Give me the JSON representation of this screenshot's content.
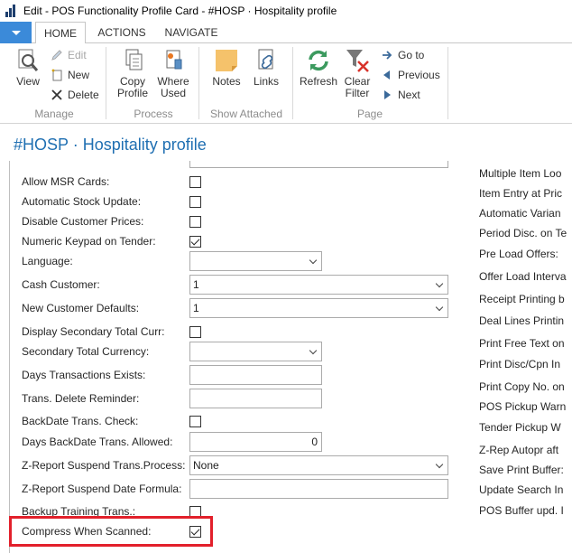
{
  "window": {
    "title": "Edit - POS Functionality Profile Card - #HOSP · Hospitality profile"
  },
  "ribbon": {
    "tabs": [
      {
        "label": "HOME"
      },
      {
        "label": "ACTIONS"
      },
      {
        "label": "NAVIGATE"
      }
    ],
    "groups": {
      "manage": {
        "label": "Manage",
        "view": "View",
        "edit": "Edit",
        "new": "New",
        "delete": "Delete"
      },
      "process": {
        "label": "Process",
        "copy_profile": "Copy Profile",
        "where_used": "Where Used"
      },
      "show_attached": {
        "label": "Show Attached",
        "notes": "Notes",
        "links": "Links"
      },
      "page": {
        "label": "Page",
        "refresh": "Refresh",
        "clear_filter": "Clear Filter",
        "go_to": "Go to",
        "previous": "Previous",
        "next": "Next"
      }
    }
  },
  "page": {
    "title": "#HOSP · Hospitality profile"
  },
  "fields": [
    {
      "label": "Allow MSR Cards:",
      "type": "checkbox",
      "checked": false
    },
    {
      "label": "Automatic Stock Update:",
      "type": "checkbox",
      "checked": false
    },
    {
      "label": "Disable Customer Prices:",
      "type": "checkbox",
      "checked": false
    },
    {
      "label": "Numeric Keypad on Tender:",
      "type": "checkbox",
      "checked": true
    },
    {
      "label": "Language:",
      "type": "select",
      "value": ""
    },
    {
      "label": "Cash Customer:",
      "type": "select",
      "value": "1"
    },
    {
      "label": "New Customer Defaults:",
      "type": "select",
      "value": "1"
    },
    {
      "label": "Display Secondary Total Curr:",
      "type": "checkbox",
      "checked": false
    },
    {
      "label": "Secondary Total Currency:",
      "type": "select",
      "value": ""
    },
    {
      "label": "Days Transactions Exists:",
      "type": "input",
      "value": ""
    },
    {
      "label": "Trans. Delete Reminder:",
      "type": "input",
      "value": ""
    },
    {
      "label": "BackDate Trans. Check:",
      "type": "checkbox",
      "checked": false
    },
    {
      "label": "Days BackDate Trans. Allowed:",
      "type": "input",
      "value": "0"
    },
    {
      "label": "Z-Report Suspend Trans.Process:",
      "type": "select",
      "value": "None"
    },
    {
      "label": "Z-Report Suspend Date Formula:",
      "type": "input",
      "value": ""
    },
    {
      "label": "Backup Training Trans.:",
      "type": "checkbox",
      "checked": false
    },
    {
      "label": "Compress When Scanned:",
      "type": "checkbox",
      "checked": true
    }
  ],
  "right_column_labels": [
    "Multiple Item Loo",
    "Item Entry at Pric",
    "Automatic Varian",
    "Period Disc. on Te",
    "Pre Load Offers:",
    "Offer Load Interva",
    "Receipt Printing b",
    "Deal Lines Printin",
    "Print Free Text on",
    "Print Disc/Cpn In",
    "Print Copy No. on",
    "POS Pickup Warn",
    "Tender Pickup W",
    "Z-Rep Autopr aft",
    "Save Print Buffer:",
    "Update Search In",
    "POS Buffer upd. I"
  ],
  "colors": {
    "accent": "#1f6fb2",
    "app_menu": "#3b8ad9",
    "highlight": "#e2202b"
  }
}
